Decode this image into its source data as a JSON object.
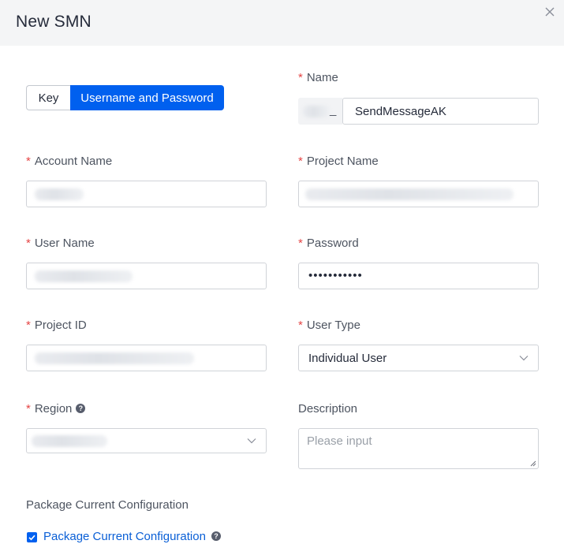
{
  "dialog": {
    "title": "New SMN",
    "close_icon": "close-icon"
  },
  "auth_toggle": {
    "options": [
      "Key",
      "Username and Password"
    ],
    "selected": "Username and Password",
    "accent": "#0060ef"
  },
  "fields": {
    "name": {
      "label": "Name",
      "required": true,
      "prefix_separator": "_",
      "value": "SendMessageAK"
    },
    "account_name": {
      "label": "Account Name",
      "required": true
    },
    "project_name": {
      "label": "Project Name",
      "required": true
    },
    "user_name": {
      "label": "User Name",
      "required": true
    },
    "password": {
      "label": "Password",
      "required": true,
      "value": "•••••••••••"
    },
    "project_id": {
      "label": "Project ID",
      "required": true
    },
    "user_type": {
      "label": "User Type",
      "required": true,
      "value": "Individual User"
    },
    "region": {
      "label": "Region",
      "required": true,
      "help_icon": "question-circle-icon"
    },
    "description": {
      "label": "Description",
      "required": false,
      "placeholder": "Please input"
    }
  },
  "package": {
    "section_label": "Package Current Configuration",
    "checkbox_label": "Package Current Configuration",
    "checked": true,
    "help_icon": "question-circle-icon"
  },
  "colors": {
    "required_marker": "#e54545",
    "link": "#0a5fd6"
  }
}
